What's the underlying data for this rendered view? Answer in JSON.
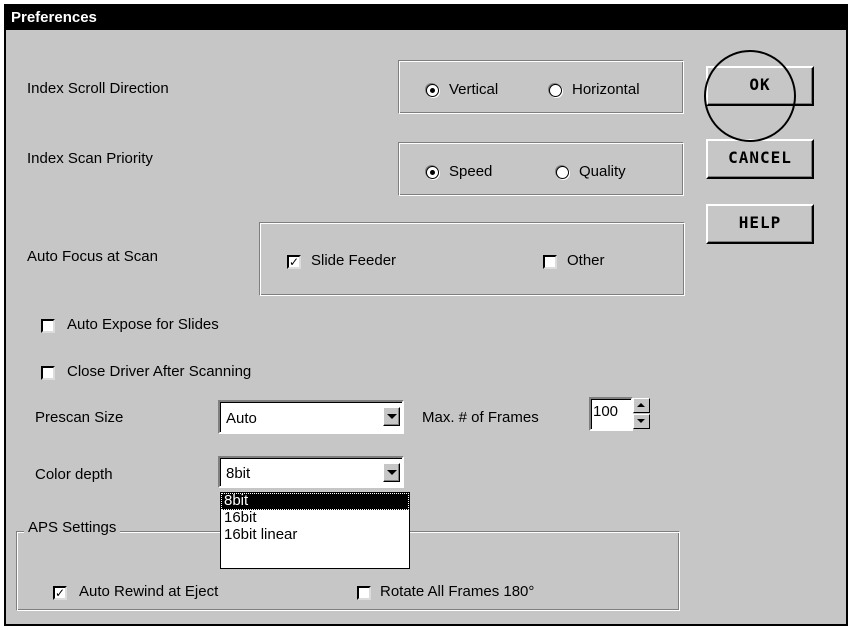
{
  "window": {
    "title": "Preferences"
  },
  "index_scroll": {
    "label": "Index Scroll Direction",
    "options": [
      {
        "label": "Vertical",
        "selected": true
      },
      {
        "label": "Horizontal",
        "selected": false
      }
    ]
  },
  "index_scan": {
    "label": "Index Scan Priority",
    "options": [
      {
        "label": "Speed",
        "selected": true
      },
      {
        "label": "Quality",
        "selected": false
      }
    ]
  },
  "auto_focus": {
    "label": "Auto Focus at Scan",
    "options": [
      {
        "label": "Slide Feeder",
        "checked": true
      },
      {
        "label": "Other",
        "checked": false
      }
    ]
  },
  "auto_expose": {
    "label": "Auto Expose for Slides",
    "checked": false
  },
  "close_driver": {
    "label": "Close Driver After Scanning",
    "checked": false
  },
  "prescan": {
    "label": "Prescan Size",
    "value": "Auto"
  },
  "max_frames": {
    "label": "Max. # of Frames",
    "value": "100"
  },
  "color_depth": {
    "label": "Color depth",
    "value": "8bit",
    "options": [
      "8bit",
      "16bit",
      "16bit linear"
    ],
    "highlighted": "8bit"
  },
  "aps": {
    "legend": "APS Settings",
    "auto_rewind": {
      "label": "Auto Rewind at Eject",
      "checked": true
    },
    "rotate": {
      "label": "Rotate All Frames 180°",
      "checked": false
    }
  },
  "buttons": {
    "ok": "OK",
    "cancel": "CANCEL",
    "help": "HELP"
  },
  "colors": {
    "window_bg": "#c6c6c6",
    "title_bg": "#000000",
    "title_fg": "#ffffff"
  },
  "icons": {
    "checkmark": "check-icon",
    "dropdown": "chevron-down-icon",
    "spin_up": "arrow-up-icon",
    "spin_down": "arrow-down-icon"
  }
}
